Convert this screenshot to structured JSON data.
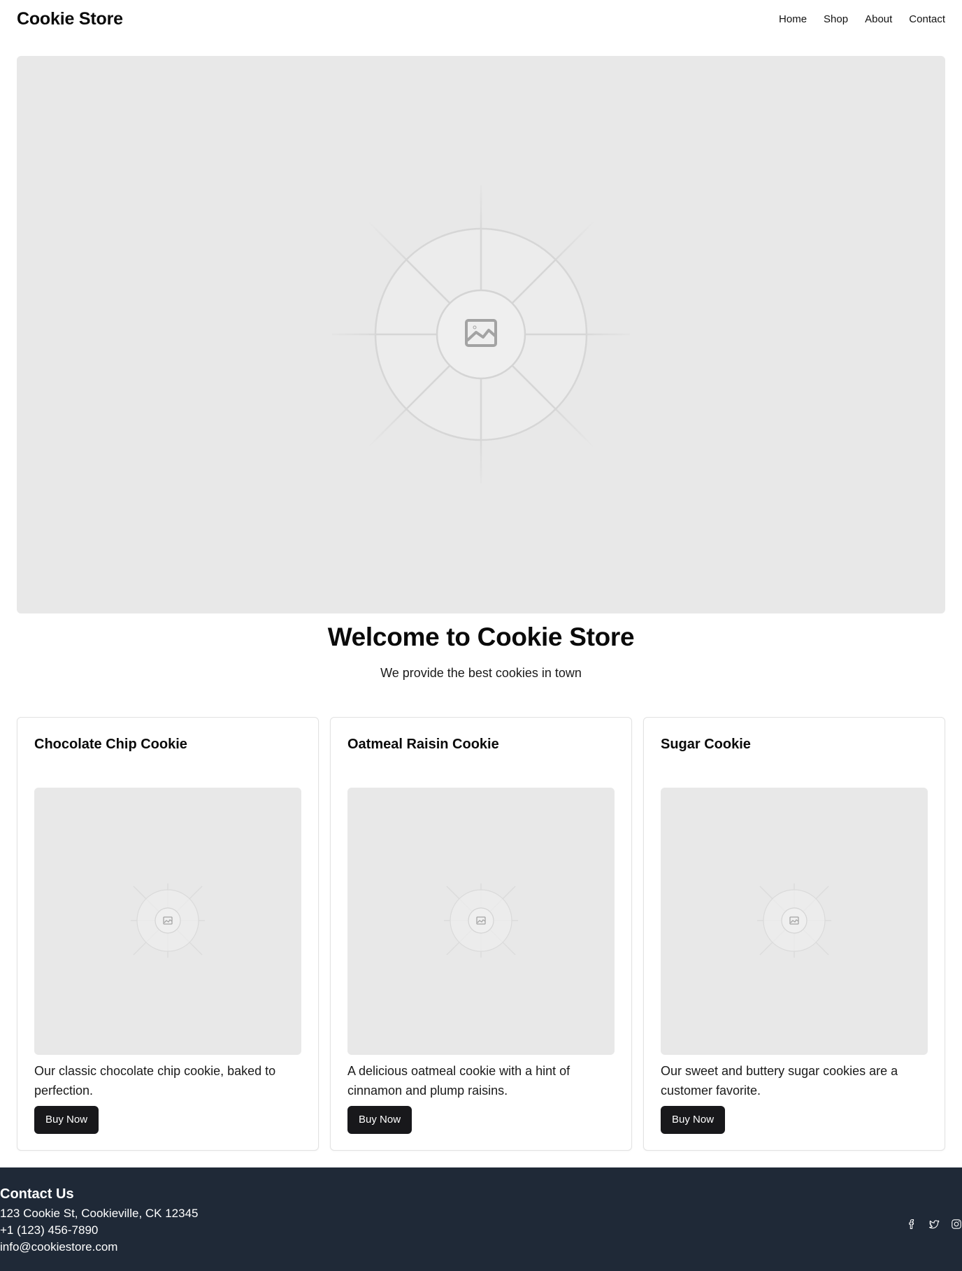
{
  "header": {
    "brand": "Cookie Store",
    "nav": [
      "Home",
      "Shop",
      "About",
      "Contact"
    ]
  },
  "hero": {
    "image_icon": "image-placeholder-icon",
    "title": "Welcome to Cookie Store",
    "subtitle": "We provide the best cookies in town"
  },
  "products": [
    {
      "name": "Chocolate Chip Cookie",
      "description": "Our classic chocolate chip cookie, baked to perfection.",
      "button": "Buy Now"
    },
    {
      "name": "Oatmeal Raisin Cookie",
      "description": "A delicious oatmeal cookie with a hint of cinnamon and plump raisins.",
      "button": "Buy Now"
    },
    {
      "name": "Sugar Cookie",
      "description": "Our sweet and buttery sugar cookies are a customer favorite.",
      "button": "Buy Now"
    }
  ],
  "footer": {
    "title": "Contact Us",
    "address": "123 Cookie St, Cookieville, CK 12345",
    "phone": "+1 (123) 456-7890",
    "email": "info@cookiestore.com",
    "social_icons": [
      "facebook-icon",
      "twitter-icon",
      "instagram-icon"
    ]
  },
  "colors": {
    "button_bg": "#18181b",
    "footer_bg": "#1f2937",
    "placeholder_bg": "#e8e8e8"
  }
}
